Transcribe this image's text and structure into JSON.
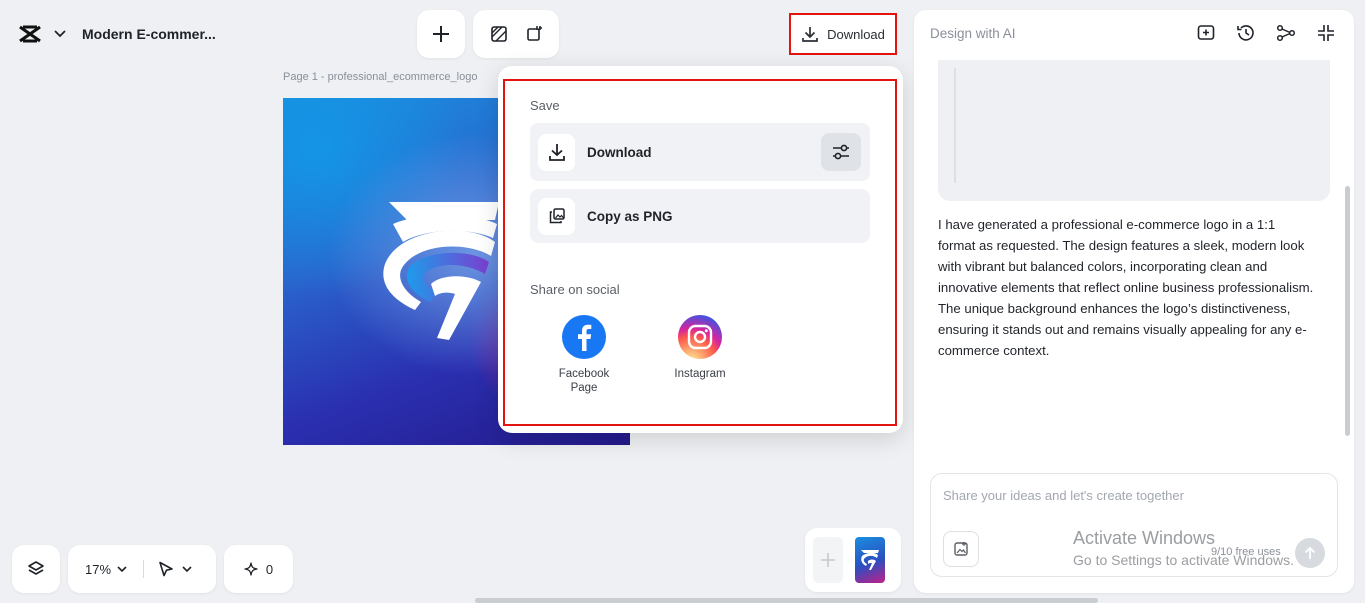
{
  "header": {
    "project_title": "Modern E-commer..."
  },
  "toolbar": {
    "download_label": "Download"
  },
  "canvas": {
    "page_label": "Page 1 -   professional_ecommerce_logo"
  },
  "download_menu": {
    "save_section": "Save",
    "download_option": "Download",
    "copy_option": "Copy as PNG",
    "share_section": "Share on social",
    "social": [
      {
        "name": "Facebook Page",
        "icon": "facebook-icon"
      },
      {
        "name": "Instagram",
        "icon": "instagram-icon"
      }
    ]
  },
  "bottom_bar": {
    "zoom": "17%",
    "credits": "0"
  },
  "ai_panel": {
    "title": "Design with AI",
    "message": "I have generated a professional e-commerce logo in a 1:1 format as requested. The design features a sleek, modern look with vibrant but balanced colors, incorporating clean and innovative elements that reflect online business professionalism. The unique background enhances the logo’s distinctiveness, ensuring it stands out and remains visually appealing for any e-commerce context.",
    "composer_placeholder": "Share your ideas and let's create together",
    "usage": "9/10 free uses"
  },
  "watermark": {
    "title": "Activate Windows",
    "subtitle": "Go to Settings to activate Windows."
  },
  "colors": {
    "highlight": "#e3140f",
    "facebook": "#1877f2"
  }
}
